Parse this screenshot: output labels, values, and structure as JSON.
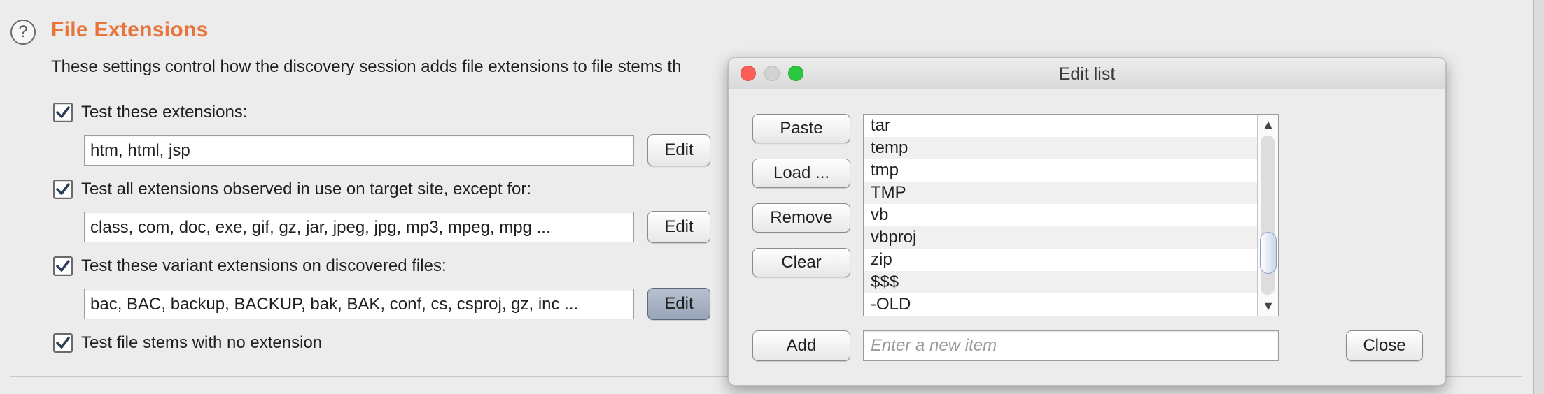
{
  "section": {
    "title": "File Extensions",
    "description": "These settings control how the discovery session adds file extensions to file stems th"
  },
  "options": [
    {
      "label": "Test these extensions:",
      "checked": true,
      "value": "htm, html, jsp",
      "edit_label": "Edit"
    },
    {
      "label": "Test all extensions observed in use on target site, except for:",
      "checked": true,
      "value": "class, com, doc, exe, gif, gz, jar, jpeg, jpg, mp3, mpeg, mpg ...",
      "edit_label": "Edit"
    },
    {
      "label": "Test these variant extensions on discovered files:",
      "checked": true,
      "value": "bac, BAC, backup, BACKUP, bak, BAK, conf, cs, csproj, gz, inc ...",
      "edit_label": "Edit"
    },
    {
      "label": "Test file stems with no extension",
      "checked": true
    }
  ],
  "dialog": {
    "title": "Edit list",
    "buttons": {
      "paste": "Paste",
      "load": "Load ...",
      "remove": "Remove",
      "clear": "Clear",
      "add": "Add",
      "close": "Close"
    },
    "items": [
      "tar",
      "temp",
      "tmp",
      "TMP",
      "vb",
      "vbproj",
      "zip",
      "$$$",
      "-OLD"
    ],
    "new_item_placeholder": "Enter a new item"
  },
  "icons": {
    "help": "help-icon",
    "check": "checkmark-icon",
    "scroll_up": "arrow-up-icon",
    "scroll_down": "arrow-down-icon"
  },
  "colors": {
    "title": "#e8733b",
    "pressed_button": "#a4afbf",
    "close_traffic": "#fc5f57",
    "zoom_traffic": "#2bc840"
  }
}
